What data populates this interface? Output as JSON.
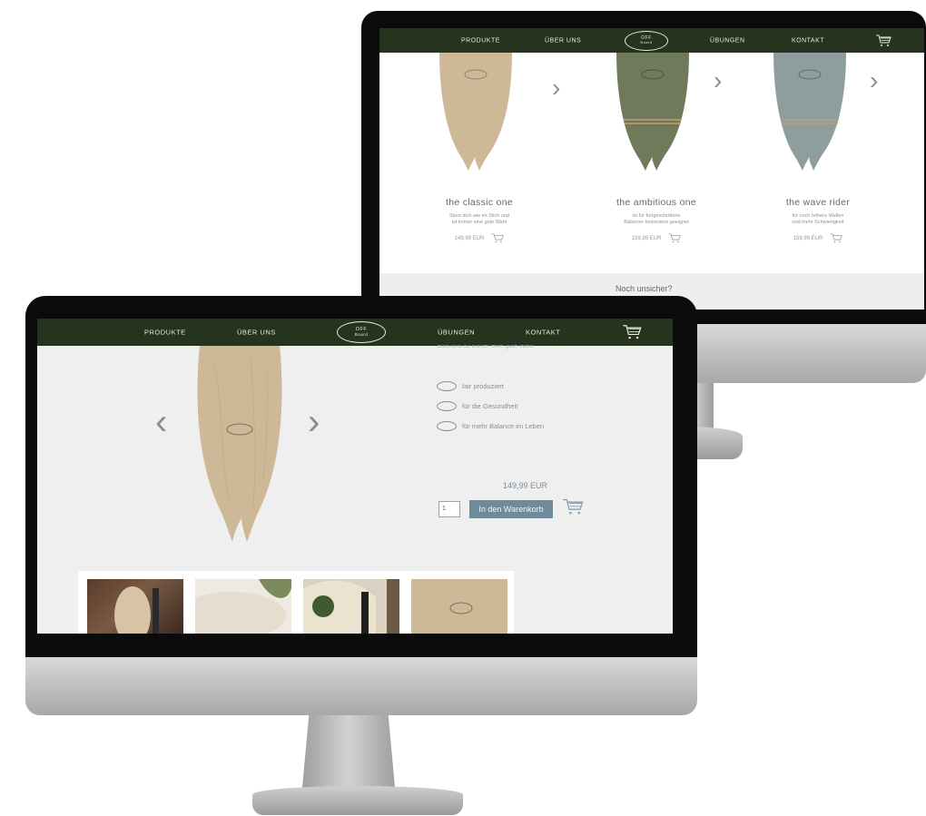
{
  "nav": {
    "items": [
      "PRODUKTE",
      "ÜBER UNS",
      "ÜBUNGEN",
      "KONTAKT"
    ],
    "logo_top": "OFF",
    "logo_bottom": "Board",
    "cart_icon": "cart-icon"
  },
  "colors": {
    "nav_bg": "#26331f",
    "accent_green": "#5b6e60",
    "button_blue": "#6f8a9b",
    "board_wood": "#cdb897",
    "board_green": "#6f7a5b",
    "board_blue": "#8e9e9e"
  },
  "back_page": {
    "products": [
      {
        "title": "the classic one",
        "desc_line1": "Stoot dich wie im Stich und",
        "desc_line2": "ist immer eine gute Wahl",
        "price": "149,99 EUR"
      },
      {
        "title": "the ambitious one",
        "desc_line1": "ist für fortgeschrittene",
        "desc_line2": "Balancer besonders geeignet",
        "price": "159,99 EUR"
      },
      {
        "title": "the wave rider",
        "desc_line1": "für noch höhere Wellen",
        "desc_line2": "und mehr Schwierigkeit",
        "price": "159,99 EUR"
      }
    ],
    "unsure_heading": "Noch unsicher?"
  },
  "front_page": {
    "cut_text": "Stoit und ist immer eine gute Wahl",
    "features": [
      "fair produziert",
      "für die Gesundheit",
      "für mehr Balance im Leben"
    ],
    "price": "149,99 EUR",
    "quantity": "1",
    "add_to_cart": "In den Warenkorb"
  }
}
